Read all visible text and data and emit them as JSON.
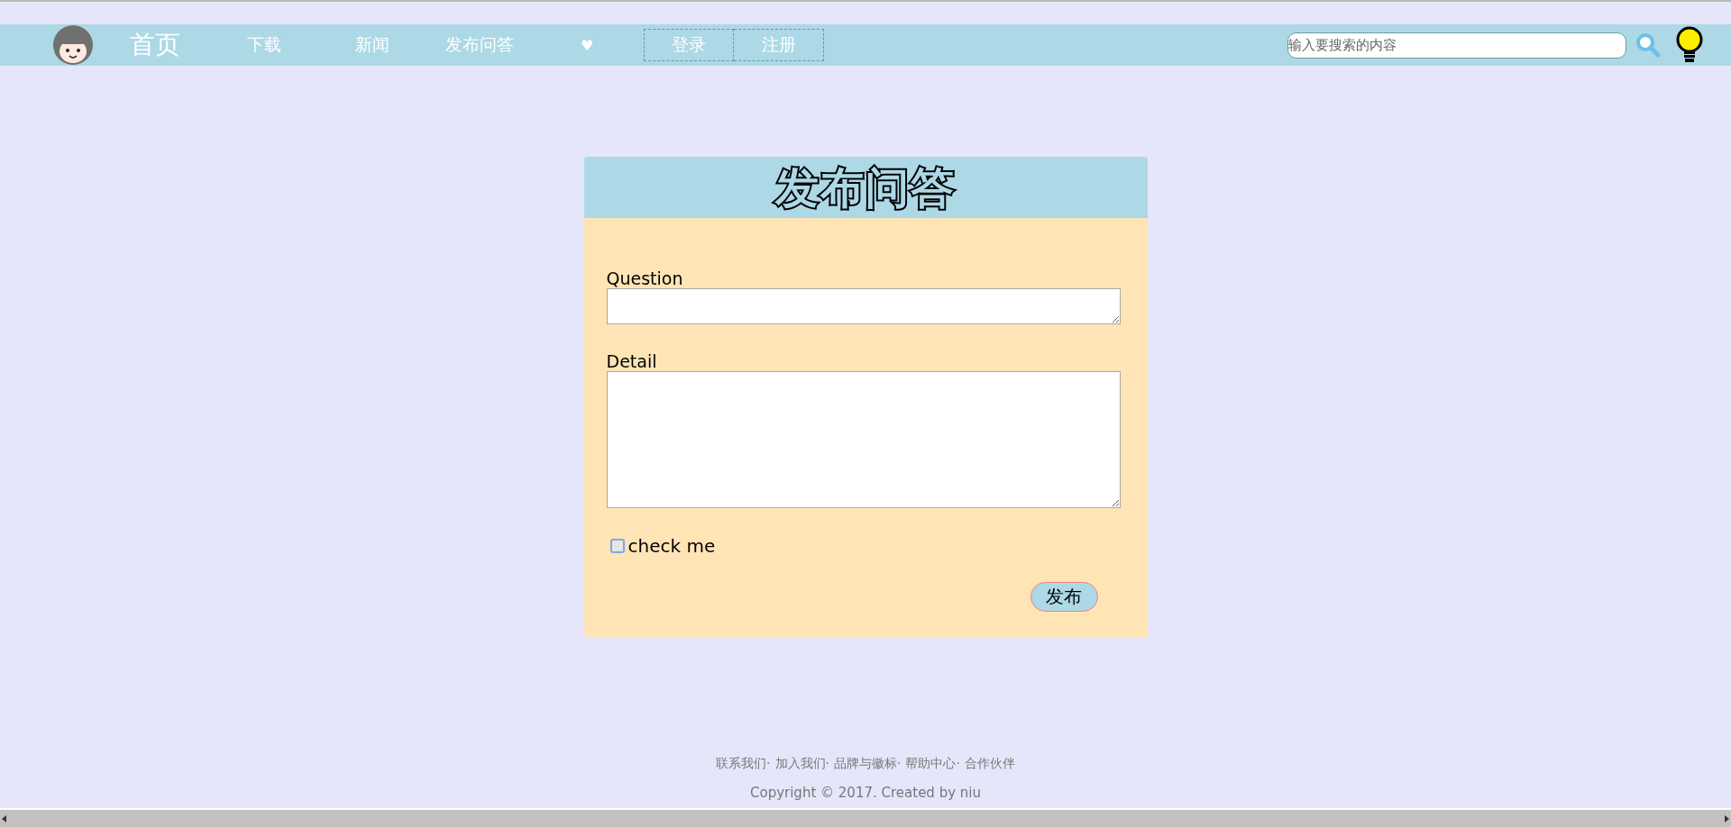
{
  "nav": {
    "home": "首页",
    "items": [
      {
        "kind": "link",
        "label": "下载"
      },
      {
        "kind": "link",
        "label": "新闻"
      },
      {
        "kind": "link",
        "label": "发布问答"
      },
      {
        "kind": "icon",
        "label": "♥"
      }
    ],
    "auth": [
      "登录",
      "注册"
    ],
    "search": {
      "placeholder": "输入要搜索的内容"
    }
  },
  "form": {
    "title": "发布问答",
    "fields": [
      {
        "kind": "short",
        "label": "Question"
      },
      {
        "kind": "long",
        "label": "Detail"
      }
    ],
    "checkbox": {
      "label": "check me",
      "checked": false
    },
    "submit": "发布"
  },
  "footer": {
    "links": [
      "联系我们·",
      "加入我们·",
      "品牌与徽标·",
      "帮助中心·",
      "合作伙伴"
    ],
    "copyright": "Copyright © 2017. Created by niu"
  }
}
